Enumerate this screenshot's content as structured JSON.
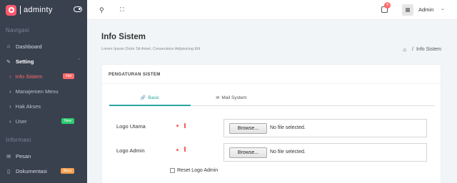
{
  "brand": {
    "name": "adminty"
  },
  "sidebar": {
    "sections": [
      {
        "title": "Navigasi"
      },
      {
        "title": "Informasi"
      }
    ],
    "items": [
      {
        "label": "Dashboard",
        "icon": "home-icon"
      },
      {
        "label": "Setting",
        "icon": "wrench-icon",
        "caret": "ˇ"
      },
      {
        "label": "Info Sistem",
        "badge": "Hot",
        "badge_color": "#ff6b6b"
      },
      {
        "label": "Manajemen Menu"
      },
      {
        "label": "Hak Akses"
      },
      {
        "label": "User",
        "badge": "New",
        "badge_color": "#2ecc71"
      },
      {
        "label": "Pesan",
        "icon": "mail-icon"
      },
      {
        "label": "Dokumentasi",
        "icon": "bookmark-icon",
        "badge": "Baca",
        "badge_color": "#f6a04d"
      }
    ]
  },
  "topbar": {
    "notifications_count": "9",
    "user_name": "Admin"
  },
  "page": {
    "title": "Info Sistem",
    "subtitle": "Lorem Ipsum Dolor Sit Amet, Consectetur Adipisicing Elit",
    "breadcrumb": {
      "sep": "/",
      "current": "Info Sistem"
    }
  },
  "card": {
    "title": "PENGATURAN SISTEM",
    "tabs": [
      {
        "label": "Basic",
        "active": true
      },
      {
        "label": "Mail System",
        "active": false
      }
    ],
    "fields": [
      {
        "label": "Logo Utama",
        "button": "Browse...",
        "status": "No file selected."
      },
      {
        "label": "Logo Admin",
        "button": "Browse...",
        "status": "No file selected."
      }
    ],
    "checkbox": {
      "label": "Reset Logo Admin",
      "checked": false
    }
  },
  "colors": {
    "accent": "#2aa5a0",
    "danger": "#ff6b6b",
    "sidebar": "#39414f"
  }
}
